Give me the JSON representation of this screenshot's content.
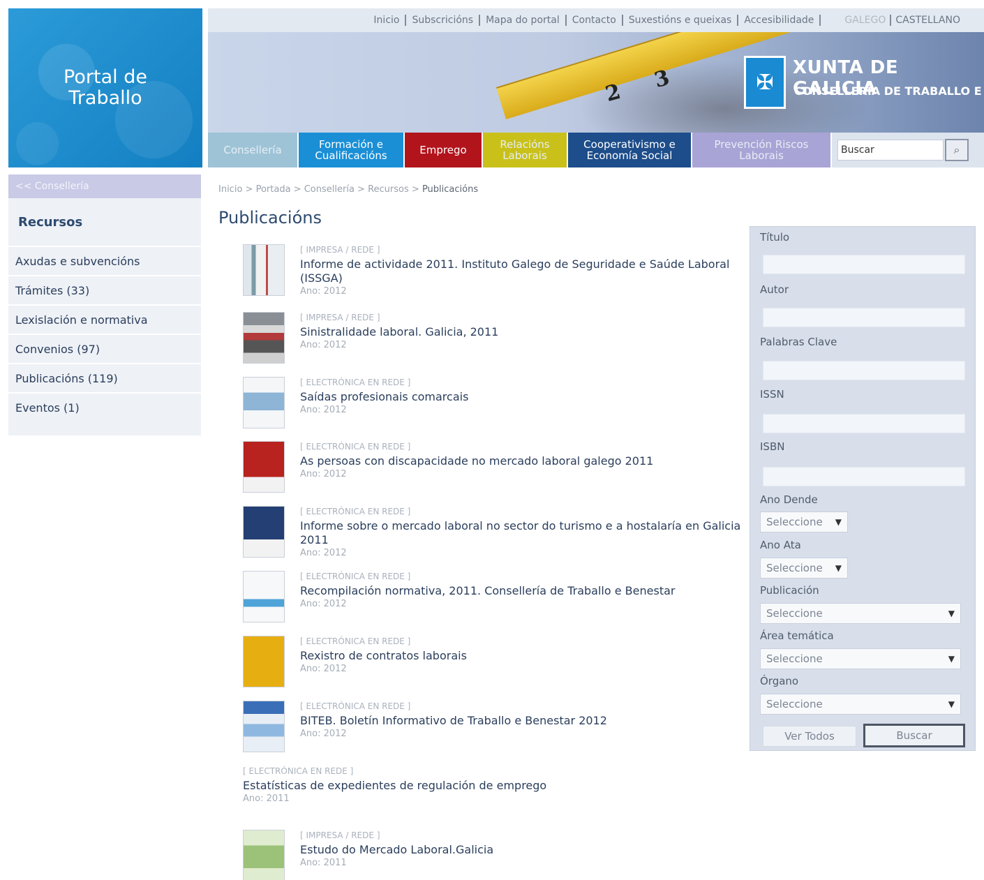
{
  "header": {
    "portal_title": "Portal de Traballo",
    "top_links": [
      "Inicio",
      "Subscricións",
      "Mapa do portal",
      "Contacto",
      "Suxestións e queixas",
      "Accesibilidade"
    ],
    "languages": [
      "GALEGO",
      "CASTELLANO"
    ],
    "brand": "XUNTA DE GALICIA",
    "department": "CONSELLERÍA DE TRABALLO E BENESTAR",
    "nav": [
      {
        "label": "Consellería",
        "color": "#9ec3d6"
      },
      {
        "label": "Formación e Cualificacións",
        "color": "#1a8fd6"
      },
      {
        "label": "Emprego",
        "color": "#b2141c"
      },
      {
        "label": "Relacións Laborais",
        "color": "#c9c11a"
      },
      {
        "label": "Cooperativismo e Economía Social",
        "color": "#1d4d8a"
      },
      {
        "label": "Prevención Riscos Laborais",
        "color": "#a9a4d6"
      }
    ],
    "search_placeholder": "Buscar"
  },
  "sidebar": {
    "back": "<< Consellería",
    "heading": "Recursos",
    "items": [
      "Axudas e subvencións",
      "Trámites (33)",
      "Lexislación e normativa",
      "Convenios (97)",
      "Publicacións (119)",
      "Eventos (1)"
    ]
  },
  "breadcrumb": {
    "items": [
      "Inicio",
      "Portada",
      "Consellería",
      "Recursos"
    ],
    "current": "Publicacións"
  },
  "page_title": "Publicacións",
  "publications": [
    {
      "type": "[ IMPRESA / REDE ]",
      "title": "Informe de actividade 2011. Instituto Galego de Seguridade e Saúde Laboral (ISSGA)",
      "year": "Ano: 2012"
    },
    {
      "type": "[ IMPRESA / REDE ]",
      "title": "Sinistralidade laboral. Galicia, 2011",
      "year": "Ano: 2012"
    },
    {
      "type": "[ ELECTRÓNICA EN REDE ]",
      "title": "Saídas profesionais comarcais",
      "year": "Ano: 2012"
    },
    {
      "type": "[ ELECTRÓNICA EN REDE ]",
      "title": "As persoas con discapacidade no mercado laboral galego 2011",
      "year": "Ano: 2012"
    },
    {
      "type": "[ ELECTRÓNICA EN REDE ]",
      "title": "Informe sobre o mercado laboral no sector do turismo e a hostalaría en Galicia 2011",
      "year": "Ano: 2012"
    },
    {
      "type": "[ ELECTRÓNICA EN REDE ]",
      "title": "Recompilación normativa, 2011. Consellería de Traballo e Benestar",
      "year": "Ano: 2012"
    },
    {
      "type": "[ ELECTRÓNICA EN REDE ]",
      "title": "Rexistro de contratos laborais",
      "year": "Ano: 2012"
    },
    {
      "type": "[ ELECTRÓNICA EN REDE ]",
      "title": "BITEB. Boletín Informativo de Traballo e Benestar 2012",
      "year": "Ano: 2012"
    },
    {
      "type": "[ ELECTRÓNICA EN REDE ]",
      "title": "Estatísticas de expedientes de regulación de emprego",
      "year": "Ano: 2011"
    },
    {
      "type": "[ IMPRESA / REDE ]",
      "title": "Estudo do Mercado Laboral.Galicia",
      "year": "Ano: 2011"
    }
  ],
  "filter": {
    "labels": [
      "Título",
      "Autor",
      "Palabras Clave",
      "ISSN",
      "ISBN",
      "Ano Dende",
      "Ano Ata",
      "Publicación",
      "Área temática",
      "Órgano"
    ],
    "select_placeholder": "Seleccione",
    "btn_all": "Ver Todos",
    "btn_search": "Buscar"
  }
}
